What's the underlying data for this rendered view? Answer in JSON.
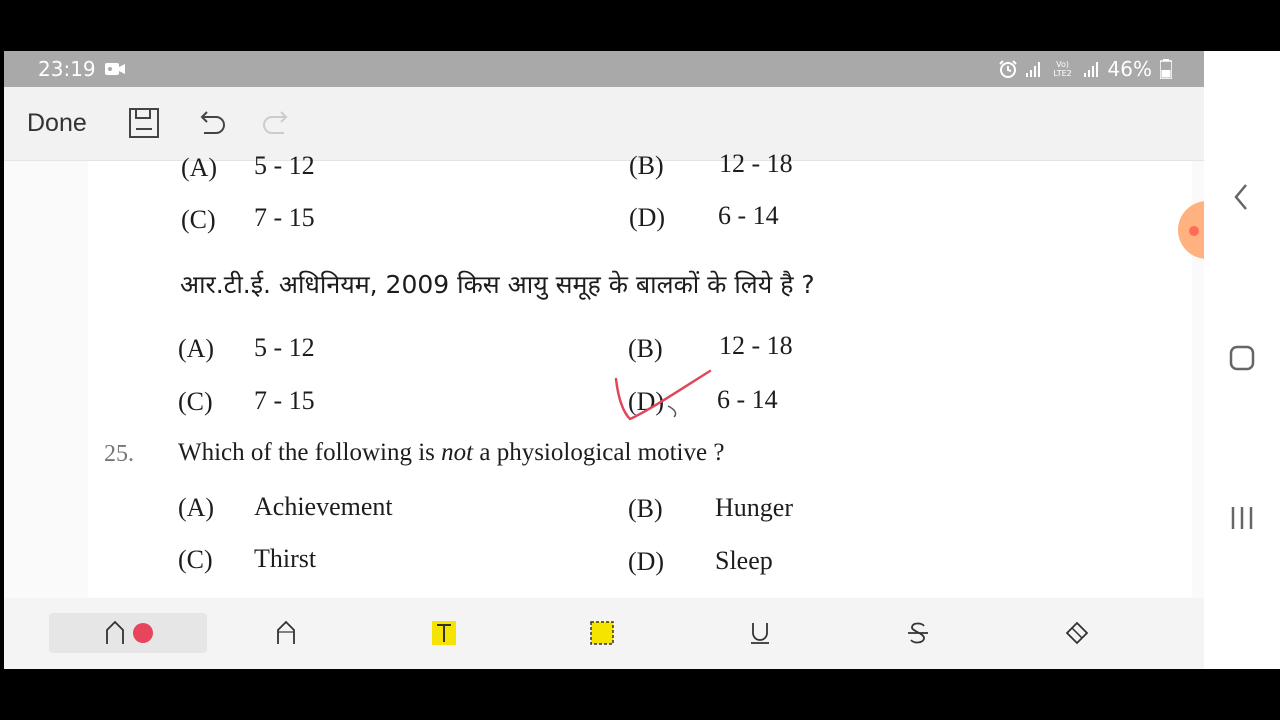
{
  "status_bar": {
    "time": "23:19",
    "icons": [
      "video-record-icon",
      "alarm-icon",
      "signal-icon",
      "volte-icon",
      "signal-icon",
      "battery-icon"
    ],
    "volte_label": "Vo) LTE2",
    "battery": "46%"
  },
  "toolbar": {
    "done_label": "Done",
    "icons": [
      "save-icon",
      "undo-icon",
      "redo-icon"
    ]
  },
  "document": {
    "prev_partial": {
      "a_label": "(A)",
      "a_value": "5 - 12",
      "b_label": "(B)",
      "b_value": "12 - 18",
      "c_label": "(C)",
      "c_value": "7 - 15",
      "d_label": "(D)",
      "d_value": "6 - 14"
    },
    "q24_hindi": {
      "stem": "आर.टी.ई. अधिनियम, 2009 किस आयु समूह के बालकों के लिये है ?",
      "a_label": "(A)",
      "a_value": "5 - 12",
      "b_label": "(B)",
      "b_value": "12 - 18",
      "c_label": "(C)",
      "c_value": "7 - 15",
      "d_label": "(D)",
      "d_value": "6 - 14"
    },
    "q25": {
      "number": "25.",
      "stem_before": "Which of the following is ",
      "stem_italic": "not",
      "stem_after": " a physiological motive ?",
      "a_label": "(A)",
      "a_value": "Achievement",
      "b_label": "(B)",
      "b_value": "Hunger",
      "c_label": "(C)",
      "c_value": "Thirst",
      "d_label": "(D)",
      "d_value": "Sleep"
    }
  },
  "annotation": {
    "mark": "checkmark",
    "color": "#e0475a"
  },
  "bottom_tools": [
    "pen-icon",
    "pencil-icon",
    "text-highlight-icon",
    "selection-icon",
    "underline-icon",
    "strikethrough-icon",
    "eraser-icon"
  ],
  "colors": {
    "pen": "#e8455c",
    "highlight": "#f5e400",
    "statusbar": "#a9a9a9",
    "side_handle": "#ff9a66"
  },
  "nav_bar": {
    "icons": [
      "back-icon",
      "home-icon",
      "recents-icon"
    ]
  }
}
